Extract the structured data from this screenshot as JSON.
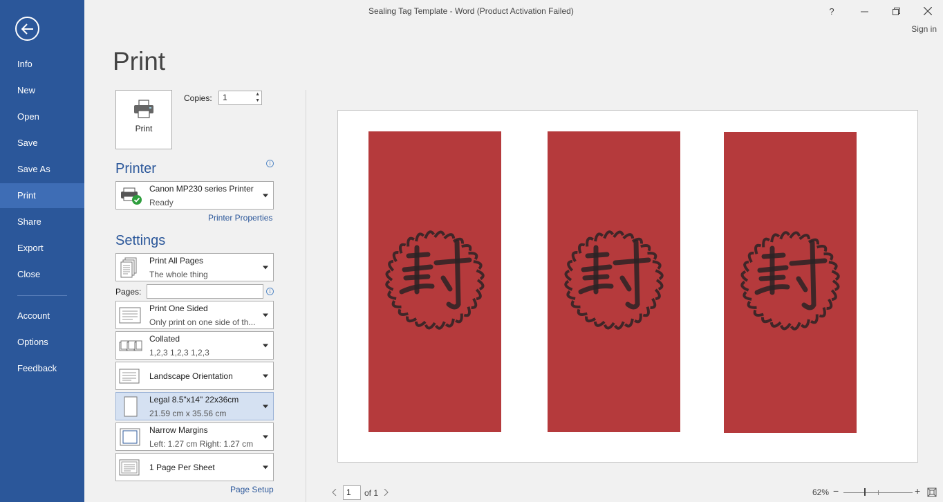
{
  "window": {
    "title": "Sealing Tag Template - Word (Product Activation Failed)",
    "help": "?",
    "sign_in": "Sign in"
  },
  "nav": {
    "items": [
      "Info",
      "New",
      "Open",
      "Save",
      "Save As",
      "Print",
      "Share",
      "Export",
      "Close"
    ],
    "bottom_items": [
      "Account",
      "Options",
      "Feedback"
    ],
    "active": "Print"
  },
  "page_title": "Print",
  "print_button": "Print",
  "copies": {
    "label": "Copies:",
    "value": "1"
  },
  "printer": {
    "heading": "Printer",
    "name": "Canon MP230 series Printer",
    "status": "Ready",
    "properties_link": "Printer Properties"
  },
  "settings": {
    "heading": "Settings",
    "pages_label": "Pages:",
    "pages_value": "",
    "options": [
      {
        "title": "Print All Pages",
        "subtitle": "The whole thing",
        "icon": "pages-icon"
      },
      {
        "title": "Print One Sided",
        "subtitle": "Only print on one side of th...",
        "icon": "one-sided-icon"
      },
      {
        "title": "Collated",
        "subtitle": "1,2,3    1,2,3    1,2,3",
        "icon": "collated-icon"
      },
      {
        "title": "Landscape Orientation",
        "subtitle": "",
        "icon": "landscape-icon"
      },
      {
        "title": "Legal 8.5\"x14\" 22x36cm",
        "subtitle": "21.59 cm x 35.56 cm",
        "icon": "paper-size-icon"
      },
      {
        "title": "Narrow Margins",
        "subtitle": "Left:  1.27 cm    Right:  1.27 cm",
        "icon": "margins-icon"
      },
      {
        "title": "1 Page Per Sheet",
        "subtitle": "",
        "icon": "pages-per-sheet-icon"
      }
    ],
    "page_setup_link": "Page Setup"
  },
  "preview": {
    "tag_color": "#b53a3c",
    "tag_count": 3
  },
  "pager": {
    "current": "1",
    "of": "of 1"
  },
  "zoom": {
    "label": "62%",
    "minus": "−",
    "plus": "+"
  }
}
